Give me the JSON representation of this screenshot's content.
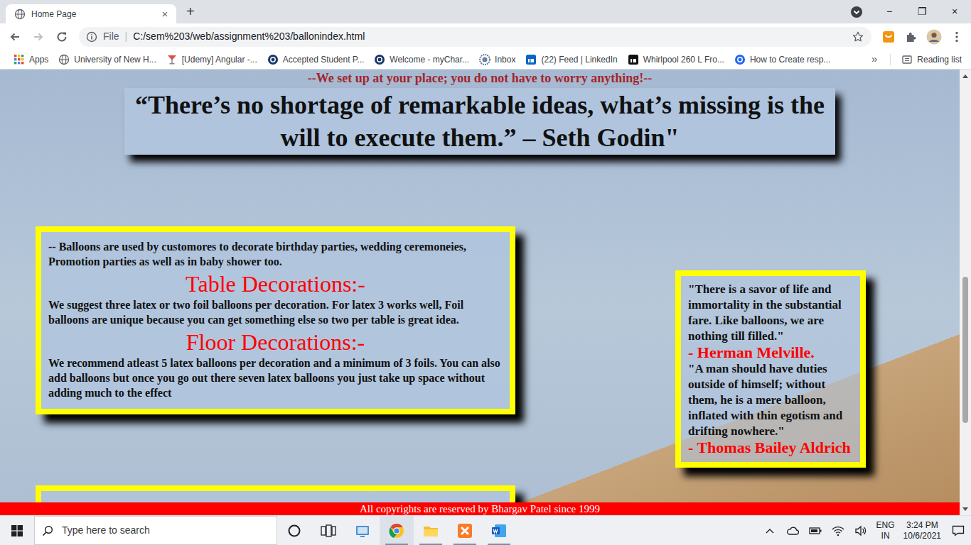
{
  "window": {
    "tab": {
      "title": "Home Page",
      "close": "×",
      "selected": true
    },
    "new_tab": "+",
    "controls": [
      "−",
      "❐",
      "×"
    ]
  },
  "toolbar": {
    "back_enabled": true,
    "forward_enabled": false,
    "site_label": "File",
    "separator": "|",
    "url": "C:/sem%203/web/assignment%203/ballonindex.html",
    "bookmarked": false
  },
  "bookmarks": {
    "apps": "Apps",
    "items": [
      {
        "label": "University of New H...",
        "kind": "globe",
        "color": "#5f6368"
      },
      {
        "label": "[Udemy] Angular -...",
        "kind": "glass",
        "color": "#d9534f"
      },
      {
        "label": "Accepted Student P...",
        "kind": "circle",
        "color": "#1b3768"
      },
      {
        "label": "Welcome - myChar...",
        "kind": "circle",
        "color": "#1b3768"
      },
      {
        "label": "Inbox",
        "kind": "seal",
        "color": "#6c7fa6"
      },
      {
        "label": "(22) Feed | LinkedIn",
        "kind": "square",
        "color": "#0a66c2"
      },
      {
        "label": "Whirlpool 260 L Fro...",
        "kind": "square",
        "color": "#111111"
      },
      {
        "label": "How to Create resp...",
        "kind": "circle",
        "color": "#1e66f5"
      }
    ],
    "more": "»",
    "reading_list": "Reading list"
  },
  "page": {
    "banner": "--We set up at your place; you do not have to worry anything!--",
    "quote": "“There’s no shortage of remarkable ideas, what’s missing is the will to execute them.” – Seth Godin\"",
    "info": {
      "intro": "-- Balloons are used by customores to decorate birthday parties, wedding ceremoneies, Promotion parties as well as in baby shower too.",
      "sections": [
        {
          "heading": "Table Decorations:-",
          "text": "We suggest three latex or two foil balloons per decoration. For latex 3 works well, Foil balloons are unique because you can get something else so two per table is great idea."
        },
        {
          "heading": "Floor Decorations:-",
          "text": "We recommend atleast 5 latex balloons per decoration and a minimum of 3 foils. You can also add balloons but once you go out there seven latex balloons you just take up space without adding much to the effect"
        }
      ]
    },
    "quotes": [
      {
        "text": "\"There is a savor of life and immortality in the substantial fare. Like balloons, we are nothing till filled.\"",
        "author": "- Herman Melville."
      },
      {
        "text": "\"A man should have duties outside of himself; without them, he is a mere balloon, inflated with thin egotism and drifting nowhere.\"",
        "author": "- Thomas Bailey Aldrich"
      }
    ],
    "footer": "All copyrights are reserved by Bhargav Patel since 1999"
  },
  "scrollbar": {
    "level": 0.71
  },
  "taskbar": {
    "search_placeholder": "Type here to search",
    "apps": [
      {
        "kind": "network",
        "running": false,
        "selected": false
      },
      {
        "kind": "chrome",
        "running": true,
        "selected": true
      },
      {
        "kind": "explorer",
        "running": true,
        "selected": false
      },
      {
        "kind": "xampp",
        "running": true,
        "selected": false
      },
      {
        "kind": "word",
        "running": true,
        "selected": false
      }
    ],
    "language": "ENG",
    "region": "IN",
    "time": "3:24 PM",
    "date": "10/6/2021"
  }
}
